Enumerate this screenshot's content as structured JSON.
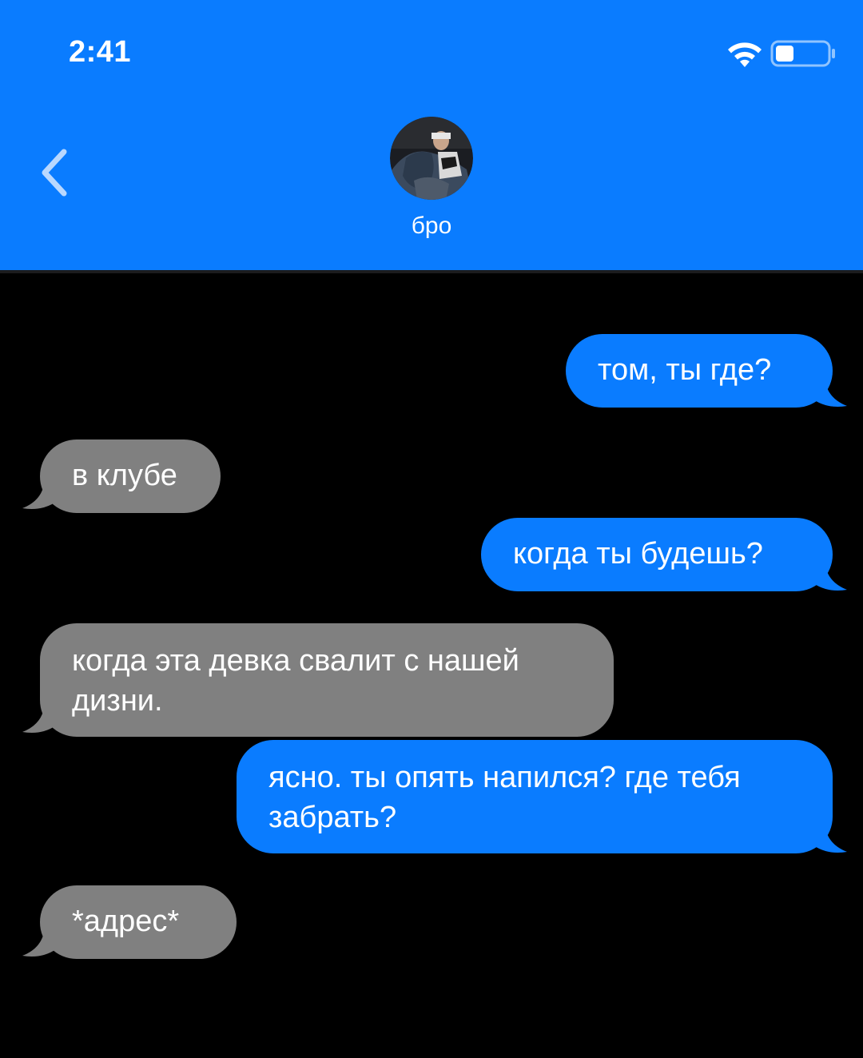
{
  "status_bar": {
    "time": "2:41",
    "icons": [
      "wifi-icon",
      "battery-icon"
    ]
  },
  "header": {
    "contact_name": "бро",
    "back_icon": "chevron-left-icon",
    "avatar": "contact-avatar"
  },
  "colors": {
    "header_bg": "#0A7CFF",
    "sent_bubble": "#0A7CFF",
    "received_bubble": "#808080",
    "background": "#000000",
    "text": "#FFFFFF"
  },
  "messages": [
    {
      "direction": "sent",
      "text": "том, ты где?"
    },
    {
      "direction": "received",
      "text": "в клубе"
    },
    {
      "direction": "sent",
      "text": "когда ты будешь?"
    },
    {
      "direction": "received",
      "text": "когда эта девка свалит с нашей дизни."
    },
    {
      "direction": "sent",
      "text": "ясно. ты опять напился? где тебя забрать?"
    },
    {
      "direction": "received",
      "text": "*адрес*"
    }
  ]
}
